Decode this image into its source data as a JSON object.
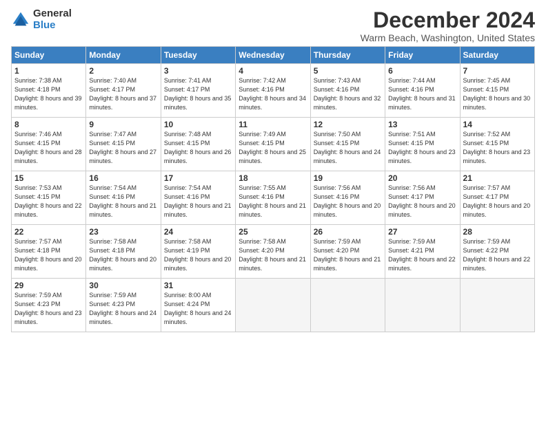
{
  "logo": {
    "general": "General",
    "blue": "Blue"
  },
  "title": "December 2024",
  "subtitle": "Warm Beach, Washington, United States",
  "days_of_week": [
    "Sunday",
    "Monday",
    "Tuesday",
    "Wednesday",
    "Thursday",
    "Friday",
    "Saturday"
  ],
  "weeks": [
    [
      {
        "day": "1",
        "sunrise": "7:38 AM",
        "sunset": "4:18 PM",
        "daylight": "8 hours and 39 minutes."
      },
      {
        "day": "2",
        "sunrise": "7:40 AM",
        "sunset": "4:17 PM",
        "daylight": "8 hours and 37 minutes."
      },
      {
        "day": "3",
        "sunrise": "7:41 AM",
        "sunset": "4:17 PM",
        "daylight": "8 hours and 35 minutes."
      },
      {
        "day": "4",
        "sunrise": "7:42 AM",
        "sunset": "4:16 PM",
        "daylight": "8 hours and 34 minutes."
      },
      {
        "day": "5",
        "sunrise": "7:43 AM",
        "sunset": "4:16 PM",
        "daylight": "8 hours and 32 minutes."
      },
      {
        "day": "6",
        "sunrise": "7:44 AM",
        "sunset": "4:16 PM",
        "daylight": "8 hours and 31 minutes."
      },
      {
        "day": "7",
        "sunrise": "7:45 AM",
        "sunset": "4:15 PM",
        "daylight": "8 hours and 30 minutes."
      }
    ],
    [
      {
        "day": "8",
        "sunrise": "7:46 AM",
        "sunset": "4:15 PM",
        "daylight": "8 hours and 28 minutes."
      },
      {
        "day": "9",
        "sunrise": "7:47 AM",
        "sunset": "4:15 PM",
        "daylight": "8 hours and 27 minutes."
      },
      {
        "day": "10",
        "sunrise": "7:48 AM",
        "sunset": "4:15 PM",
        "daylight": "8 hours and 26 minutes."
      },
      {
        "day": "11",
        "sunrise": "7:49 AM",
        "sunset": "4:15 PM",
        "daylight": "8 hours and 25 minutes."
      },
      {
        "day": "12",
        "sunrise": "7:50 AM",
        "sunset": "4:15 PM",
        "daylight": "8 hours and 24 minutes."
      },
      {
        "day": "13",
        "sunrise": "7:51 AM",
        "sunset": "4:15 PM",
        "daylight": "8 hours and 23 minutes."
      },
      {
        "day": "14",
        "sunrise": "7:52 AM",
        "sunset": "4:15 PM",
        "daylight": "8 hours and 23 minutes."
      }
    ],
    [
      {
        "day": "15",
        "sunrise": "7:53 AM",
        "sunset": "4:15 PM",
        "daylight": "8 hours and 22 minutes."
      },
      {
        "day": "16",
        "sunrise": "7:54 AM",
        "sunset": "4:16 PM",
        "daylight": "8 hours and 21 minutes."
      },
      {
        "day": "17",
        "sunrise": "7:54 AM",
        "sunset": "4:16 PM",
        "daylight": "8 hours and 21 minutes."
      },
      {
        "day": "18",
        "sunrise": "7:55 AM",
        "sunset": "4:16 PM",
        "daylight": "8 hours and 21 minutes."
      },
      {
        "day": "19",
        "sunrise": "7:56 AM",
        "sunset": "4:16 PM",
        "daylight": "8 hours and 20 minutes."
      },
      {
        "day": "20",
        "sunrise": "7:56 AM",
        "sunset": "4:17 PM",
        "daylight": "8 hours and 20 minutes."
      },
      {
        "day": "21",
        "sunrise": "7:57 AM",
        "sunset": "4:17 PM",
        "daylight": "8 hours and 20 minutes."
      }
    ],
    [
      {
        "day": "22",
        "sunrise": "7:57 AM",
        "sunset": "4:18 PM",
        "daylight": "8 hours and 20 minutes."
      },
      {
        "day": "23",
        "sunrise": "7:58 AM",
        "sunset": "4:18 PM",
        "daylight": "8 hours and 20 minutes."
      },
      {
        "day": "24",
        "sunrise": "7:58 AM",
        "sunset": "4:19 PM",
        "daylight": "8 hours and 20 minutes."
      },
      {
        "day": "25",
        "sunrise": "7:58 AM",
        "sunset": "4:20 PM",
        "daylight": "8 hours and 21 minutes."
      },
      {
        "day": "26",
        "sunrise": "7:59 AM",
        "sunset": "4:20 PM",
        "daylight": "8 hours and 21 minutes."
      },
      {
        "day": "27",
        "sunrise": "7:59 AM",
        "sunset": "4:21 PM",
        "daylight": "8 hours and 22 minutes."
      },
      {
        "day": "28",
        "sunrise": "7:59 AM",
        "sunset": "4:22 PM",
        "daylight": "8 hours and 22 minutes."
      }
    ],
    [
      {
        "day": "29",
        "sunrise": "7:59 AM",
        "sunset": "4:23 PM",
        "daylight": "8 hours and 23 minutes."
      },
      {
        "day": "30",
        "sunrise": "7:59 AM",
        "sunset": "4:23 PM",
        "daylight": "8 hours and 24 minutes."
      },
      {
        "day": "31",
        "sunrise": "8:00 AM",
        "sunset": "4:24 PM",
        "daylight": "8 hours and 24 minutes."
      },
      null,
      null,
      null,
      null
    ]
  ]
}
